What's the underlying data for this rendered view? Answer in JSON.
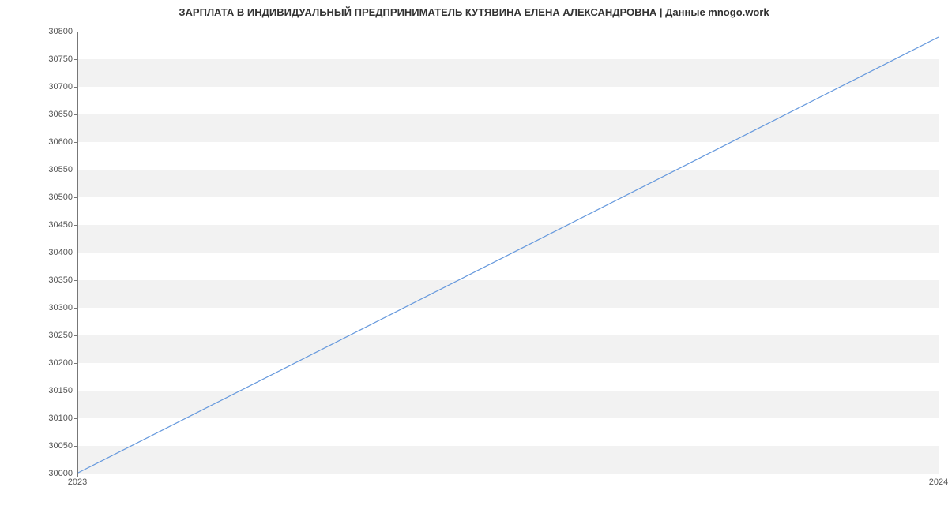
{
  "chart_data": {
    "type": "line",
    "title": "ЗАРПЛАТА В ИНДИВИДУАЛЬНЫЙ ПРЕДПРИНИМАТЕЛЬ КУТЯВИНА ЕЛЕНА АЛЕКСАНДРОВНА | Данные mnogo.work",
    "x": [
      "2023",
      "2024"
    ],
    "values": [
      30000,
      30790
    ],
    "xlabel": "",
    "ylabel": "",
    "ylim": [
      30000,
      30800
    ],
    "y_ticks": [
      30000,
      30050,
      30100,
      30150,
      30200,
      30250,
      30300,
      30350,
      30400,
      30450,
      30500,
      30550,
      30600,
      30650,
      30700,
      30750,
      30800
    ],
    "x_ticks": [
      "2023",
      "2024"
    ],
    "line_color": "#6699dd",
    "band_color": "#f2f2f2"
  }
}
